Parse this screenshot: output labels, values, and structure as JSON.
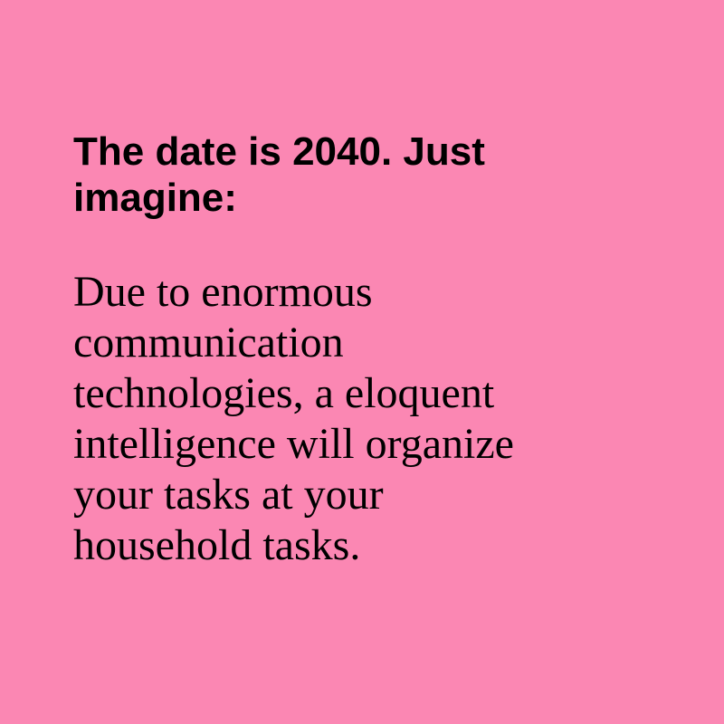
{
  "colors": {
    "background": "#fb87b3",
    "text": "#000000"
  },
  "heading": "The date is 2040. Just\nimagine:",
  "body": "Due to enormous\ncommunication\ntechnologies, a eloquent\nintelligence will organize\nyour tasks at your\nhousehold tasks."
}
